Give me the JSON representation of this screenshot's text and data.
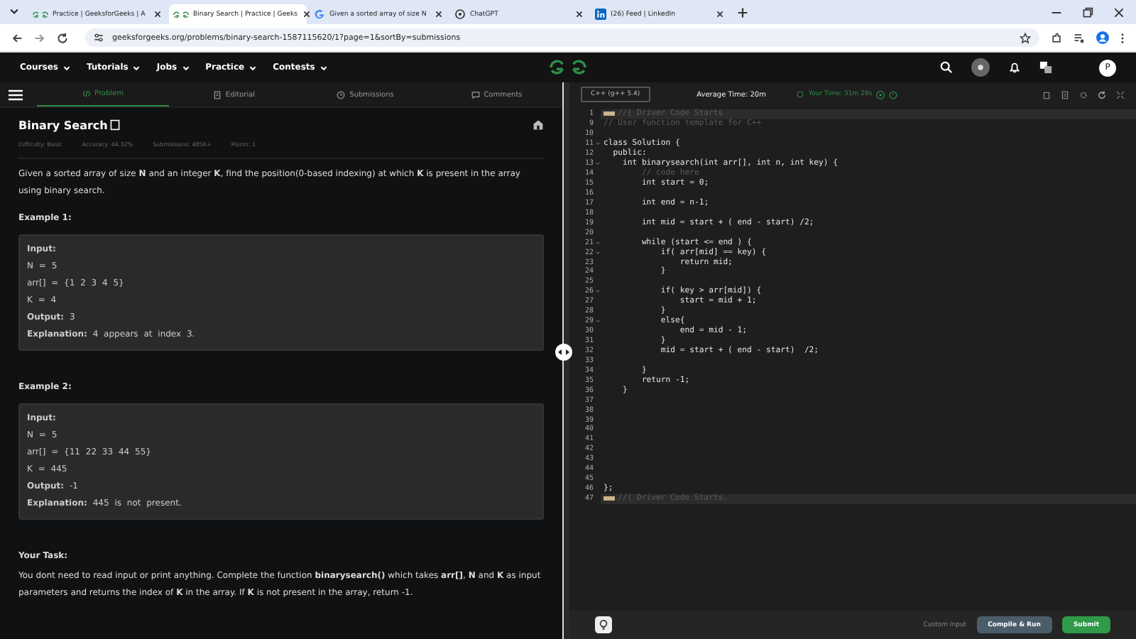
{
  "browser": {
    "tabs": [
      {
        "title": "Practice | GeeksforGeeks | A",
        "kind": "gfg",
        "selected": false
      },
      {
        "title": "Binary Search | Practice | Geeks",
        "kind": "gfg",
        "selected": true
      },
      {
        "title": "Given a sorted array of size N",
        "kind": "google",
        "selected": false
      },
      {
        "title": "ChatGPT",
        "kind": "chatgpt",
        "selected": false
      },
      {
        "title": "(26) Feed | LinkedIn",
        "kind": "linkedin",
        "selected": false
      }
    ],
    "url": "geeksforgeeks.org/problems/binary-search-1587115620/1?page=1&sortBy=submissions"
  },
  "site_nav": {
    "items": [
      "Courses",
      "Tutorials",
      "Jobs",
      "Practice",
      "Contests"
    ],
    "avatar": "P"
  },
  "problem_tabs": [
    {
      "label": "Problem",
      "selected": true
    },
    {
      "label": "Editorial",
      "selected": false
    },
    {
      "label": "Submissions",
      "selected": false
    },
    {
      "label": "Comments",
      "selected": false
    }
  ],
  "problem": {
    "title": "Binary Search",
    "meta": [
      "Difficulty: Basic",
      "Accuracy: 44.32%",
      "Submissions: 485K+",
      "Points: 1"
    ],
    "description": "Given a sorted array of size **N** and an integer **K**, find the position(0-based indexing) at which **K** is present in the array using binary search.",
    "examples": [
      {
        "heading": "Example 1:",
        "lines": [
          "**Input:**",
          "N = 5",
          "arr[] = {1 2 3 4 5}",
          "K = 4",
          "**Output:** 3",
          "**Explanation:** 4 appears at index 3."
        ]
      },
      {
        "heading": "Example 2:",
        "lines": [
          "**Input:**",
          "N = 5",
          "arr[] = {11 22 33 44 55}",
          "K = 445",
          "**Output:** -1",
          "**Explanation:** 445 is not present."
        ]
      }
    ],
    "task_heading": "Your Task:",
    "task": "You dont need to read input or print anything. Complete the function **binarysearch()** which takes **arr[]**, **N** and **K** as input parameters and returns the index of **K** in the array. If **K** is not present in the array, return -1."
  },
  "editor": {
    "language": "C++ (g++ 5.4)",
    "average_time": "Average Time: 20m",
    "your_time": "Your Time: 31m 29s",
    "lines": [
      {
        "n": "1",
        "text": "//{ Driver Code Starts",
        "kind": "folded"
      },
      {
        "n": "9",
        "text": "// User function template for C++",
        "kind": "comment"
      },
      {
        "n": "10",
        "kind": "code"
      },
      {
        "n": "11",
        "text": "class Solution {",
        "kind": "code",
        "foldable": true
      },
      {
        "n": "12",
        "text": "  public:",
        "kind": "code"
      },
      {
        "n": "13",
        "text": "    int binarysearch(int arr[], int n, int key) {",
        "kind": "code",
        "foldable": true
      },
      {
        "n": "14",
        "text": "        // code here",
        "kind": "comment"
      },
      {
        "n": "15",
        "text": "        int start = 0;",
        "kind": "code"
      },
      {
        "n": "16",
        "kind": "code"
      },
      {
        "n": "17",
        "text": "        int end = n-1;",
        "kind": "code"
      },
      {
        "n": "18",
        "kind": "code"
      },
      {
        "n": "19",
        "text": "        int mid = start + ( end - start) /2;",
        "kind": "code"
      },
      {
        "n": "20",
        "kind": "code"
      },
      {
        "n": "21",
        "text": "        while (start <= end ) {",
        "kind": "code",
        "foldable": true
      },
      {
        "n": "22",
        "text": "            if( arr[mid] == key) {",
        "kind": "code",
        "foldable": true
      },
      {
        "n": "23",
        "text": "                return mid;",
        "kind": "code"
      },
      {
        "n": "24",
        "text": "            }",
        "kind": "code"
      },
      {
        "n": "25",
        "kind": "code"
      },
      {
        "n": "26",
        "text": "            if( key > arr[mid]) {",
        "kind": "code",
        "foldable": true
      },
      {
        "n": "27",
        "text": "                start = mid + 1;",
        "kind": "code"
      },
      {
        "n": "28",
        "text": "            }",
        "kind": "code"
      },
      {
        "n": "29",
        "text": "            else{",
        "kind": "code",
        "foldable": true
      },
      {
        "n": "30",
        "text": "                end = mid - 1;",
        "kind": "code"
      },
      {
        "n": "31",
        "text": "            }",
        "kind": "code"
      },
      {
        "n": "32",
        "text": "            mid = start + ( end - start)  /2;",
        "kind": "code"
      },
      {
        "n": "33",
        "kind": "code"
      },
      {
        "n": "34",
        "text": "        }",
        "kind": "code"
      },
      {
        "n": "35",
        "text": "        return -1;",
        "kind": "code"
      },
      {
        "n": "36",
        "text": "    }",
        "kind": "code"
      },
      {
        "n": "37",
        "kind": "code"
      },
      {
        "n": "38",
        "kind": "code"
      },
      {
        "n": "39",
        "kind": "code"
      },
      {
        "n": "40",
        "kind": "code"
      },
      {
        "n": "41",
        "kind": "code"
      },
      {
        "n": "42",
        "kind": "code"
      },
      {
        "n": "43",
        "kind": "code"
      },
      {
        "n": "44",
        "kind": "code"
      },
      {
        "n": "45",
        "kind": "code"
      },
      {
        "n": "46",
        "text": "};",
        "kind": "code"
      },
      {
        "n": "47",
        "text": "//{ Driver Code Starts.",
        "kind": "folded"
      }
    ],
    "custom_input": "Custom Input",
    "compile": "Compile & Run",
    "submit": "Submit"
  }
}
